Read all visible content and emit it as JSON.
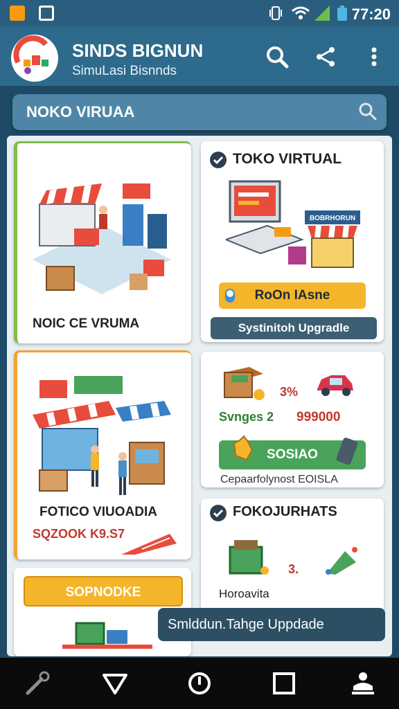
{
  "status_bar": {
    "time": "77:20"
  },
  "app_bar": {
    "title": "SINDS BIGNUN",
    "subtitle": "SimuLasi Bisnnds"
  },
  "search": {
    "value": "NOKO VIRUAA"
  },
  "cards": {
    "card1": {
      "caption": "NOIC CE VRUMA"
    },
    "card2": {
      "title": "TOKO VIRTUAL",
      "sign": "BOBRHORUN",
      "button": "RoOn IAsne",
      "subbutton": "Systinitoh Upgradle"
    },
    "card3": {
      "caption": "FOTICO VIUOADIA",
      "price": "SQZOOK K9.S7"
    },
    "card4": {
      "pct": "3%",
      "stat_label": "Svnges 2",
      "stat_value": "999000",
      "button": "SOSIAO",
      "footer": "Cepaarfolynost EOISLA"
    },
    "card5": {
      "button": "SOPNODKE"
    },
    "card6": {
      "title": "FOKOJURHATS",
      "num": "3.",
      "footer": "Horoavita"
    }
  },
  "overlay_button": "Smlddun.Tahge Uppdade",
  "colors": {
    "app_bar": "#2d6a8b",
    "accent_green": "#7cbf4a",
    "accent_orange": "#f0a434",
    "button_yellow": "#f5b52a",
    "button_green": "#4aa35a",
    "dark_pill": "#3c5f73"
  },
  "icons": [
    "search-icon",
    "share-icon",
    "more-vert-icon",
    "back-icon",
    "home-icon",
    "recent-icon",
    "accessibility-icon",
    "wifi-icon",
    "battery-icon"
  ]
}
